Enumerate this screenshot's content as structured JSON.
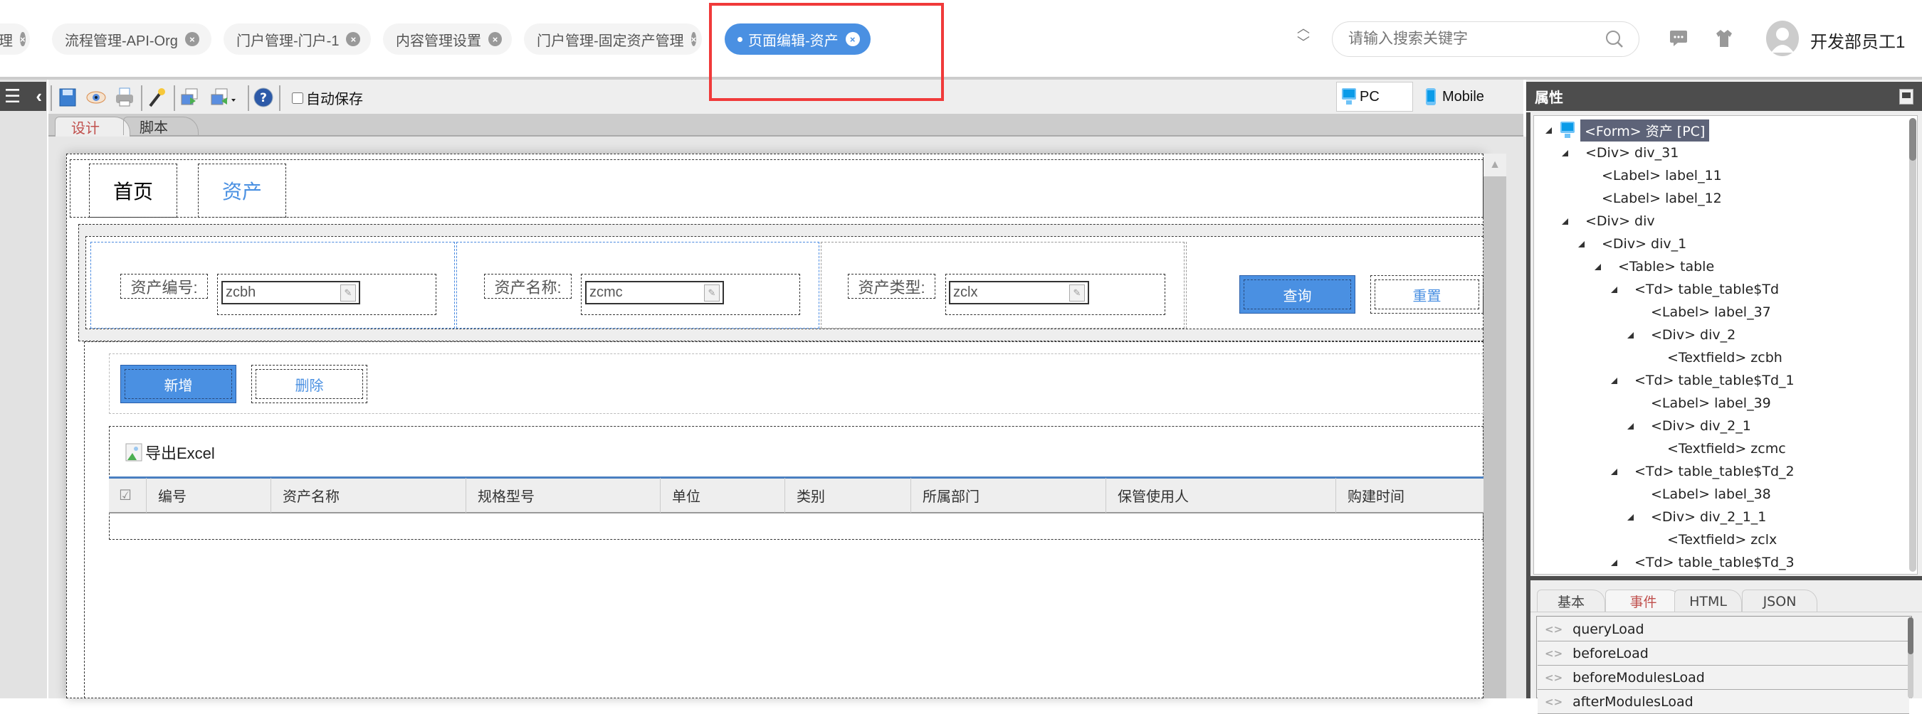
{
  "header": {
    "tabs": [
      {
        "label": "理",
        "active": false
      },
      {
        "label": "流程管理-API-Org",
        "active": false
      },
      {
        "label": "门户管理-门户-1",
        "active": false
      },
      {
        "label": "内容管理设置",
        "active": false
      },
      {
        "label": "门户管理-固定资产管理",
        "active": false
      },
      {
        "label": "页面编辑-资产",
        "active": true
      }
    ],
    "close_glyph": "×",
    "search_placeholder": "请输入搜索关键字",
    "user_name": "开发部员工1",
    "accent": "#4a90e2"
  },
  "toolbar": {
    "autosave_label": "自动保存",
    "autosave_checked": false,
    "icons": [
      "save-icon",
      "preview-icon",
      "print-icon",
      "wand-icon",
      "import-icon",
      "export-icon",
      "help-icon"
    ],
    "view_pc": "PC",
    "view_mobile": "Mobile"
  },
  "editor_tabs": [
    {
      "label": "设计",
      "active": true
    },
    {
      "label": "脚本",
      "active": false
    }
  ],
  "form": {
    "nav": [
      {
        "label": "首页",
        "active": false
      },
      {
        "label": "资产",
        "active": true
      }
    ],
    "query": [
      {
        "label": "资产编号:",
        "field": "zcbh"
      },
      {
        "label": "资产名称:",
        "field": "zcmc"
      },
      {
        "label": "资产类型:",
        "field": "zclx"
      }
    ],
    "query_button": "查询",
    "reset_button": "重置",
    "add_button": "新增",
    "delete_button": "删除",
    "export_label": "导出Excel",
    "columns": [
      "编号",
      "资产名称",
      "规格型号",
      "单位",
      "类别",
      "所属部门",
      "保管使用人",
      "购建时间"
    ]
  },
  "properties": {
    "title": "属性",
    "tree": [
      {
        "text": "<Form> 资产 [PC]",
        "level": 0,
        "expandable": true,
        "selected": true
      },
      {
        "text": "<Div> div_31",
        "level": 1,
        "expandable": true
      },
      {
        "text": "<Label> label_11",
        "level": 2,
        "expandable": false
      },
      {
        "text": "<Label> label_12",
        "level": 2,
        "expandable": false
      },
      {
        "text": "<Div> div",
        "level": 1,
        "expandable": true
      },
      {
        "text": "<Div> div_1",
        "level": 2,
        "expandable": true
      },
      {
        "text": "<Table> table",
        "level": 3,
        "expandable": true
      },
      {
        "text": "<Td> table_table$Td",
        "level": 4,
        "expandable": true
      },
      {
        "text": "<Label> label_37",
        "level": 5,
        "expandable": false
      },
      {
        "text": "<Div> div_2",
        "level": 5,
        "expandable": true
      },
      {
        "text": "<Textfield> zcbh",
        "level": 6,
        "expandable": false
      },
      {
        "text": "<Td> table_table$Td_1",
        "level": 4,
        "expandable": true
      },
      {
        "text": "<Label> label_39",
        "level": 5,
        "expandable": false
      },
      {
        "text": "<Div> div_2_1",
        "level": 5,
        "expandable": true
      },
      {
        "text": "<Textfield> zcmc",
        "level": 6,
        "expandable": false
      },
      {
        "text": "<Td> table_table$Td_2",
        "level": 4,
        "expandable": true
      },
      {
        "text": "<Label> label_38",
        "level": 5,
        "expandable": false
      },
      {
        "text": "<Div> div_2_1_1",
        "level": 5,
        "expandable": true
      },
      {
        "text": "<Textfield> zclx",
        "level": 6,
        "expandable": false
      },
      {
        "text": "<Td> table_table$Td_3",
        "level": 4,
        "expandable": true
      }
    ],
    "tabs": [
      {
        "label": "基本",
        "active": false
      },
      {
        "label": "事件",
        "active": true
      },
      {
        "label": "HTML",
        "active": false
      },
      {
        "label": "JSON",
        "active": false
      }
    ],
    "events": [
      "queryLoad",
      "beforeLoad",
      "beforeModulesLoad",
      "afterModulesLoad"
    ]
  }
}
